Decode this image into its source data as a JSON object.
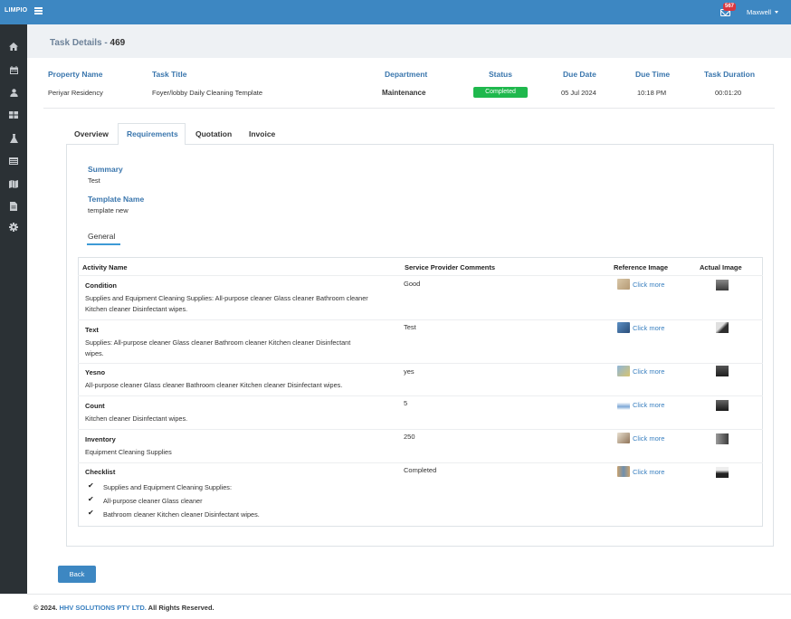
{
  "topbar": {
    "brand": "LIMPIO",
    "notification_count": "567",
    "user_name": "Maxwell"
  },
  "sidebar": {
    "icons": [
      "home-icon",
      "calendar-icon",
      "user-icon",
      "grid-icon",
      "flask-icon",
      "list-icon",
      "map-icon",
      "file-icon",
      "gear-icon"
    ]
  },
  "page": {
    "title_prefix": "Task Details - ",
    "task_id": "469"
  },
  "task_header": {
    "labels": {
      "property": "Property Name",
      "title": "Task Title",
      "department": "Department",
      "status": "Status",
      "due_date": "Due Date",
      "due_time": "Due Time",
      "duration": "Task Duration"
    },
    "values": {
      "property": "Periyar Residency",
      "title": "Foyer/lobby Daily Cleaning Template",
      "department": "Maintenance",
      "status": "Completed",
      "due_date": "05 Jul 2024",
      "due_time": "10:18 PM",
      "duration": "00:01:20"
    }
  },
  "tabs": [
    "Overview",
    "Requirements",
    "Quotation",
    "Invoice"
  ],
  "requirements": {
    "summary_label": "Summary",
    "summary_value": "Test",
    "template_label": "Template Name",
    "template_value": "template new",
    "sub_tab": "General",
    "table": {
      "headers": {
        "activity": "Activity Name",
        "comments": "Service Provider Comments",
        "reference": "Reference Image",
        "actual": "Actual Image"
      },
      "rows": [
        {
          "name": "Condition",
          "desc1": "Supplies and Equipment Cleaning Supplies: All-purpose cleaner Glass cleaner Bathroom cleaner",
          "desc2": "Kitchen cleaner Disinfectant wipes.",
          "comment": "Good",
          "link": "Click more"
        },
        {
          "name": "Text",
          "desc1": "Supplies: All-purpose cleaner Glass cleaner Bathroom cleaner Kitchen cleaner Disinfectant",
          "desc2": "wipes.",
          "comment": "Test",
          "link": "Click more"
        },
        {
          "name": "Yesno",
          "desc1": "All-purpose cleaner Glass cleaner Bathroom cleaner Kitchen cleaner Disinfectant wipes.",
          "desc2": "",
          "comment": "yes",
          "link": "Click more"
        },
        {
          "name": "Count",
          "desc1": "Kitchen cleaner Disinfectant wipes.",
          "desc2": "",
          "comment": "5",
          "link": "Click more"
        },
        {
          "name": "Inventory",
          "desc1": "Equipment Cleaning Supplies",
          "desc2": "",
          "comment": "250",
          "link": "Click more"
        },
        {
          "name": "Checklist",
          "desc1": "",
          "desc2": "",
          "comment": "Completed",
          "link": "Click more"
        }
      ],
      "checklist": [
        "Supplies and Equipment Cleaning Supplies:",
        "All-purpose cleaner Glass cleaner",
        "Bathroom cleaner Kitchen cleaner Disinfectant wipes."
      ]
    }
  },
  "back_label": "Back",
  "footer": {
    "prefix": "© 2024. ",
    "company": "HHV SOLUTIONS PTY LTD.",
    "suffix": " All Rights Reserved."
  }
}
